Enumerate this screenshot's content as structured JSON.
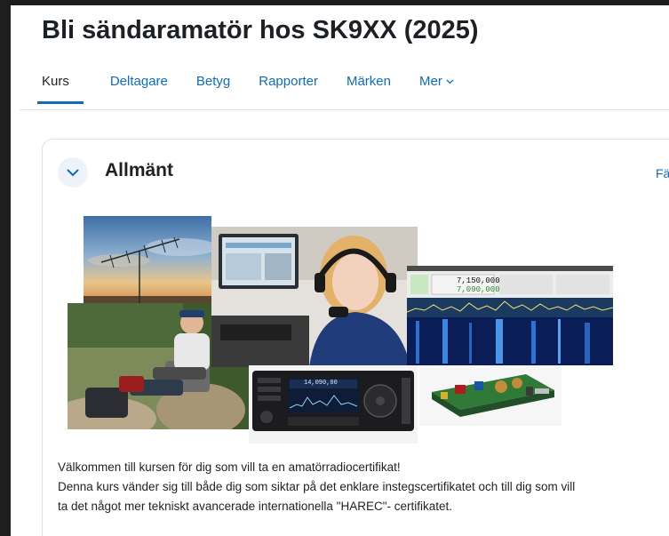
{
  "course": {
    "title": "Bli sändaramatör hos SK9XX (2025)"
  },
  "nav": {
    "items": [
      {
        "label": "Kurs"
      },
      {
        "label": "Deltagare"
      },
      {
        "label": "Betyg"
      },
      {
        "label": "Rapporter"
      },
      {
        "label": "Märken"
      },
      {
        "label": "Mer"
      }
    ]
  },
  "section": {
    "title": "Allmänt",
    "collapse_link": "Fä"
  },
  "sdr": {
    "freq1": "7,150,000",
    "freq2": "7,090,000"
  },
  "radio": {
    "freq": "14,090,00"
  },
  "intro": {
    "line1": "Välkommen till kursen för dig som vill ta en amatörradiocertifikat!",
    "line2": "Denna kurs vänder sig till både dig som siktar på det enklare instegscertifikatet och till dig som vill",
    "line3": "ta det något mer tekniskt avancerade internationella \"HAREC\"- certifikatet."
  }
}
